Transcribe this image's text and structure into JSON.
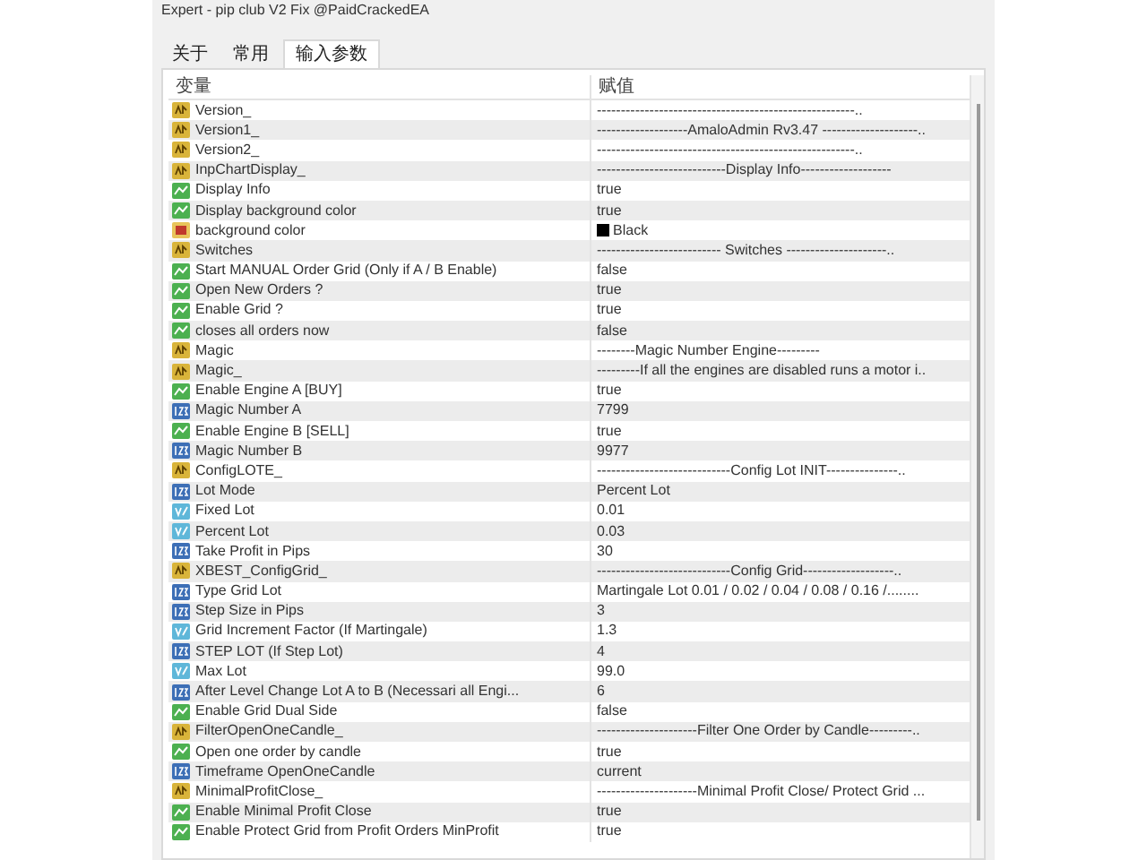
{
  "window": {
    "title": "Expert - pip club V2 Fix @PaidCrackedEA"
  },
  "tabs": [
    {
      "label": "关于",
      "selected": false
    },
    {
      "label": "常用",
      "selected": false
    },
    {
      "label": "输入参数",
      "selected": true
    }
  ],
  "table": {
    "columns": [
      "变量",
      "赋值"
    ],
    "rows": [
      {
        "kind": "string",
        "name": "Version_",
        "value": "------------------------------------------------------.."
      },
      {
        "kind": "string",
        "name": "Version1_",
        "value": "-------------------AmaloAdmin   Rv3.47 --------------------.."
      },
      {
        "kind": "string",
        "name": "Version2_",
        "value": "------------------------------------------------------.."
      },
      {
        "kind": "string",
        "name": "InpChartDisplay_",
        "value": "---------------------------Display Info-------------------"
      },
      {
        "kind": "bool",
        "name": "Display Info",
        "value": "true"
      },
      {
        "kind": "bool",
        "name": "Display background color",
        "value": "true"
      },
      {
        "kind": "color",
        "name": "background color",
        "value": "Black",
        "color": "#000000"
      },
      {
        "kind": "string",
        "name": "Switches",
        "value": "-------------------------- Switches ---------------------.."
      },
      {
        "kind": "bool",
        "name": "Start MANUAL Order  Grid  (Only if A / B Enable)",
        "value": "false"
      },
      {
        "kind": "bool",
        "name": "Open New Orders ?",
        "value": "true"
      },
      {
        "kind": "bool",
        "name": "Enable Grid ?",
        "value": "true"
      },
      {
        "kind": "bool",
        "name": "closes all orders now",
        "value": "false"
      },
      {
        "kind": "string",
        "name": "Magic",
        "value": "--------Magic Number Engine---------"
      },
      {
        "kind": "string",
        "name": "Magic_",
        "value": "---------If all the engines are disabled runs a motor i.."
      },
      {
        "kind": "bool",
        "name": "Enable Engine A   [BUY]",
        "value": "true"
      },
      {
        "kind": "int",
        "name": "Magic Number  A",
        "value": "7799"
      },
      {
        "kind": "bool",
        "name": "Enable Engine B   [SELL]",
        "value": "true"
      },
      {
        "kind": "int",
        "name": "Magic Number  B",
        "value": "9977"
      },
      {
        "kind": "string",
        "name": "ConfigLOTE_",
        "value": "----------------------------Config Lot INIT---------------.."
      },
      {
        "kind": "int",
        "name": "Lot Mode",
        "value": "Percent Lot"
      },
      {
        "kind": "double",
        "name": "Fixed Lot",
        "value": "0.01"
      },
      {
        "kind": "double",
        "name": "Percent Lot",
        "value": "0.03"
      },
      {
        "kind": "int",
        "name": "Take Profit in Pips",
        "value": "30"
      },
      {
        "kind": "string",
        "name": "XBEST_ConfigGrid_",
        "value": "----------------------------Config Grid-------------------.."
      },
      {
        "kind": "int",
        "name": "Type Grid Lot",
        "value": "Martingale Lot  0.01 / 0.02 / 0.04 / 0.08 / 0.16 /........"
      },
      {
        "kind": "int",
        "name": "Step Size in Pips",
        "value": "3"
      },
      {
        "kind": "double",
        "name": "Grid Increment Factor (If Martingale)",
        "value": "1.3"
      },
      {
        "kind": "int",
        "name": "STEP LOT (If  Step Lot)",
        "value": "4"
      },
      {
        "kind": "double",
        "name": "Max Lot",
        "value": "99.0"
      },
      {
        "kind": "int",
        "name": "After Level Change Lot A to B (Necessari all Engi...",
        "value": "6"
      },
      {
        "kind": "bool",
        "name": "Enable Grid Dual Side",
        "value": "false"
      },
      {
        "kind": "string",
        "name": "FilterOpenOneCandle_",
        "value": "---------------------Filter One Order by Candle---------.."
      },
      {
        "kind": "bool",
        "name": "Open one order by candle",
        "value": "true"
      },
      {
        "kind": "int",
        "name": "Timeframe OpenOneCandle",
        "value": "current"
      },
      {
        "kind": "string",
        "name": "MinimalProfitClose_",
        "value": "---------------------Minimal Profit Close/ Protect Grid ..."
      },
      {
        "kind": "bool",
        "name": "Enable  Minimal Profit Close",
        "value": "true"
      },
      {
        "kind": "bool",
        "name": "Enable Protect Grid from Profit Orders MinProfit",
        "value": "true"
      }
    ]
  }
}
